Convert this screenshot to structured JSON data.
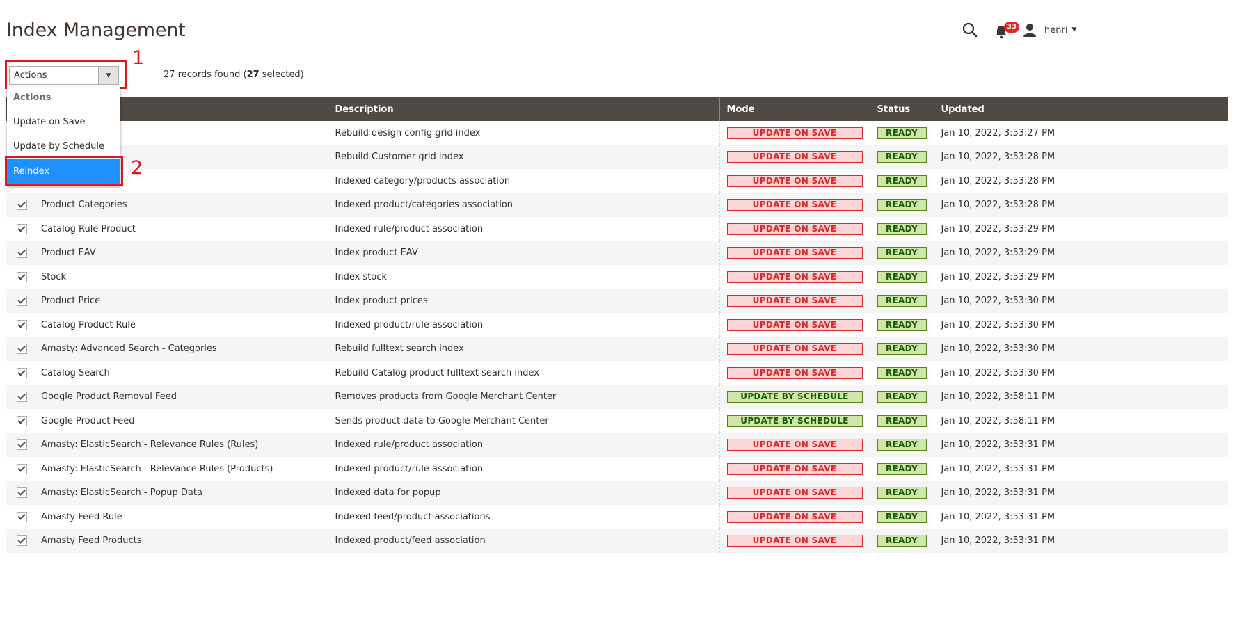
{
  "page": {
    "title": "Index Management"
  },
  "header": {
    "notification_count": "33",
    "username": "henri"
  },
  "toolbar": {
    "actions_label": "Actions",
    "records_count": "27",
    "records_text": " records found (",
    "selected_count": "27",
    "selected_text": " selected)"
  },
  "dropdown": {
    "header": "Actions",
    "items": [
      "Update on Save",
      "Update by Schedule",
      "Reindex"
    ]
  },
  "annotations": [
    "1",
    "2"
  ],
  "grid": {
    "columns": [
      "",
      "Description",
      "Mode",
      "Status",
      "Updated"
    ],
    "rows": [
      {
        "name": "",
        "description": "Rebuild design config grid index",
        "mode": "UPDATE ON SAVE",
        "status": "READY",
        "updated": "Jan 10, 2022, 3:53:27 PM"
      },
      {
        "name": "",
        "description": "Rebuild Customer grid index",
        "mode": "UPDATE ON SAVE",
        "status": "READY",
        "updated": "Jan 10, 2022, 3:53:28 PM"
      },
      {
        "name": "",
        "description": "Indexed category/products association",
        "mode": "UPDATE ON SAVE",
        "status": "READY",
        "updated": "Jan 10, 2022, 3:53:28 PM"
      },
      {
        "name": "Product Categories",
        "description": "Indexed product/categories association",
        "mode": "UPDATE ON SAVE",
        "status": "READY",
        "updated": "Jan 10, 2022, 3:53:28 PM"
      },
      {
        "name": "Catalog Rule Product",
        "description": "Indexed rule/product association",
        "mode": "UPDATE ON SAVE",
        "status": "READY",
        "updated": "Jan 10, 2022, 3:53:29 PM"
      },
      {
        "name": "Product EAV",
        "description": "Index product EAV",
        "mode": "UPDATE ON SAVE",
        "status": "READY",
        "updated": "Jan 10, 2022, 3:53:29 PM"
      },
      {
        "name": "Stock",
        "description": "Index stock",
        "mode": "UPDATE ON SAVE",
        "status": "READY",
        "updated": "Jan 10, 2022, 3:53:29 PM"
      },
      {
        "name": "Product Price",
        "description": "Index product prices",
        "mode": "UPDATE ON SAVE",
        "status": "READY",
        "updated": "Jan 10, 2022, 3:53:30 PM"
      },
      {
        "name": "Catalog Product Rule",
        "description": "Indexed product/rule association",
        "mode": "UPDATE ON SAVE",
        "status": "READY",
        "updated": "Jan 10, 2022, 3:53:30 PM"
      },
      {
        "name": "Amasty: Advanced Search - Categories",
        "description": "Rebuild fulltext search index",
        "mode": "UPDATE ON SAVE",
        "status": "READY",
        "updated": "Jan 10, 2022, 3:53:30 PM"
      },
      {
        "name": "Catalog Search",
        "description": "Rebuild Catalog product fulltext search index",
        "mode": "UPDATE ON SAVE",
        "status": "READY",
        "updated": "Jan 10, 2022, 3:53:30 PM"
      },
      {
        "name": "Google Product Removal Feed",
        "description": "Removes products from Google Merchant Center",
        "mode": "UPDATE BY SCHEDULE",
        "status": "READY",
        "updated": "Jan 10, 2022, 3:58:11 PM"
      },
      {
        "name": "Google Product Feed",
        "description": "Sends product data to Google Merchant Center",
        "mode": "UPDATE BY SCHEDULE",
        "status": "READY",
        "updated": "Jan 10, 2022, 3:58:11 PM"
      },
      {
        "name": "Amasty: ElasticSearch - Relevance Rules (Rules)",
        "description": "Indexed rule/product association",
        "mode": "UPDATE ON SAVE",
        "status": "READY",
        "updated": "Jan 10, 2022, 3:53:31 PM"
      },
      {
        "name": "Amasty: ElasticSearch - Relevance Rules (Products)",
        "description": "Indexed product/rule association",
        "mode": "UPDATE ON SAVE",
        "status": "READY",
        "updated": "Jan 10, 2022, 3:53:31 PM"
      },
      {
        "name": "Amasty: ElasticSearch - Popup Data",
        "description": "Indexed data for popup",
        "mode": "UPDATE ON SAVE",
        "status": "READY",
        "updated": "Jan 10, 2022, 3:53:31 PM"
      },
      {
        "name": "Amasty Feed Rule",
        "description": "Indexed feed/product associations",
        "mode": "UPDATE ON SAVE",
        "status": "READY",
        "updated": "Jan 10, 2022, 3:53:31 PM"
      },
      {
        "name": "Amasty Feed Products",
        "description": "Indexed product/feed association",
        "mode": "UPDATE ON SAVE",
        "status": "READY",
        "updated": "Jan 10, 2022, 3:53:31 PM"
      }
    ]
  }
}
